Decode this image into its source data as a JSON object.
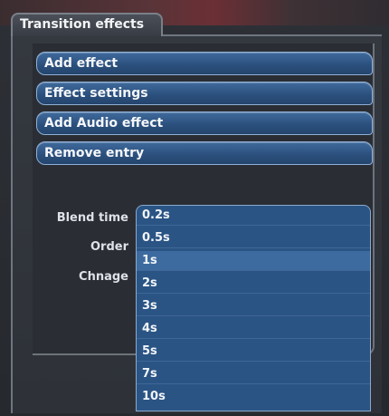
{
  "panel": {
    "tab_title": "Transition effects"
  },
  "menu": {
    "add_effect": "Add effect",
    "effect_settings": "Effect settings",
    "add_audio_effect": "Add Audio effect",
    "remove_entry": "Remove entry"
  },
  "fields": {
    "blend_time_label": "Blend time",
    "order_label": "Order",
    "change_label": "Chnage"
  },
  "blend_time_dropdown": {
    "options": [
      "0.2s",
      "0.5s",
      "1s",
      "2s",
      "3s",
      "4s",
      "5s",
      "7s",
      "10s"
    ],
    "highlighted": "1s"
  }
}
